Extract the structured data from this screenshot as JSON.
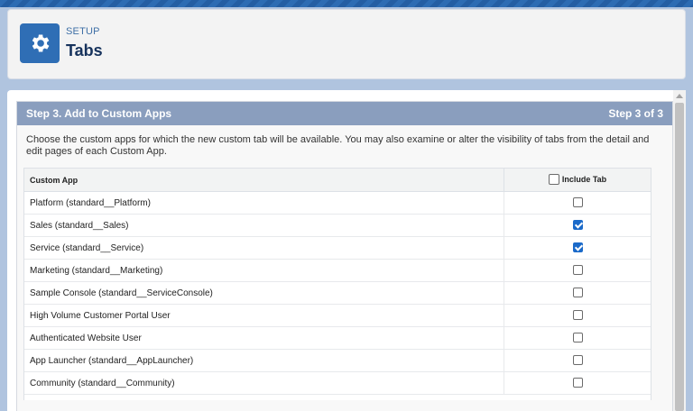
{
  "header": {
    "setup_label": "SETUP",
    "title": "Tabs",
    "icon": "gear-icon"
  },
  "panel": {
    "title": "Step 3. Add to Custom Apps",
    "step": "Step 3 of 3",
    "description": "Choose the custom apps for which the new custom tab will be available. You may also examine or alter the visibility of tabs from the detail and edit pages of each Custom App."
  },
  "table": {
    "col_app": "Custom App",
    "col_include": "Include Tab",
    "rows": [
      {
        "app": "Platform (standard__Platform)",
        "checked": false
      },
      {
        "app": "Sales (standard__Sales)",
        "checked": true
      },
      {
        "app": "Service (standard__Service)",
        "checked": true
      },
      {
        "app": "Marketing (standard__Marketing)",
        "checked": false
      },
      {
        "app": "Sample Console (standard__ServiceConsole)",
        "checked": false
      },
      {
        "app": "High Volume Customer Portal User",
        "checked": false
      },
      {
        "app": "Authenticated Website User",
        "checked": false
      },
      {
        "app": "App Launcher (standard__AppLauncher)",
        "checked": false
      },
      {
        "app": "Community (standard__Community)",
        "checked": false
      }
    ]
  },
  "colors": {
    "panel_header": "#8a9ebe",
    "checked": "#1b6ac9",
    "icon_bg": "#2f6eb5"
  }
}
